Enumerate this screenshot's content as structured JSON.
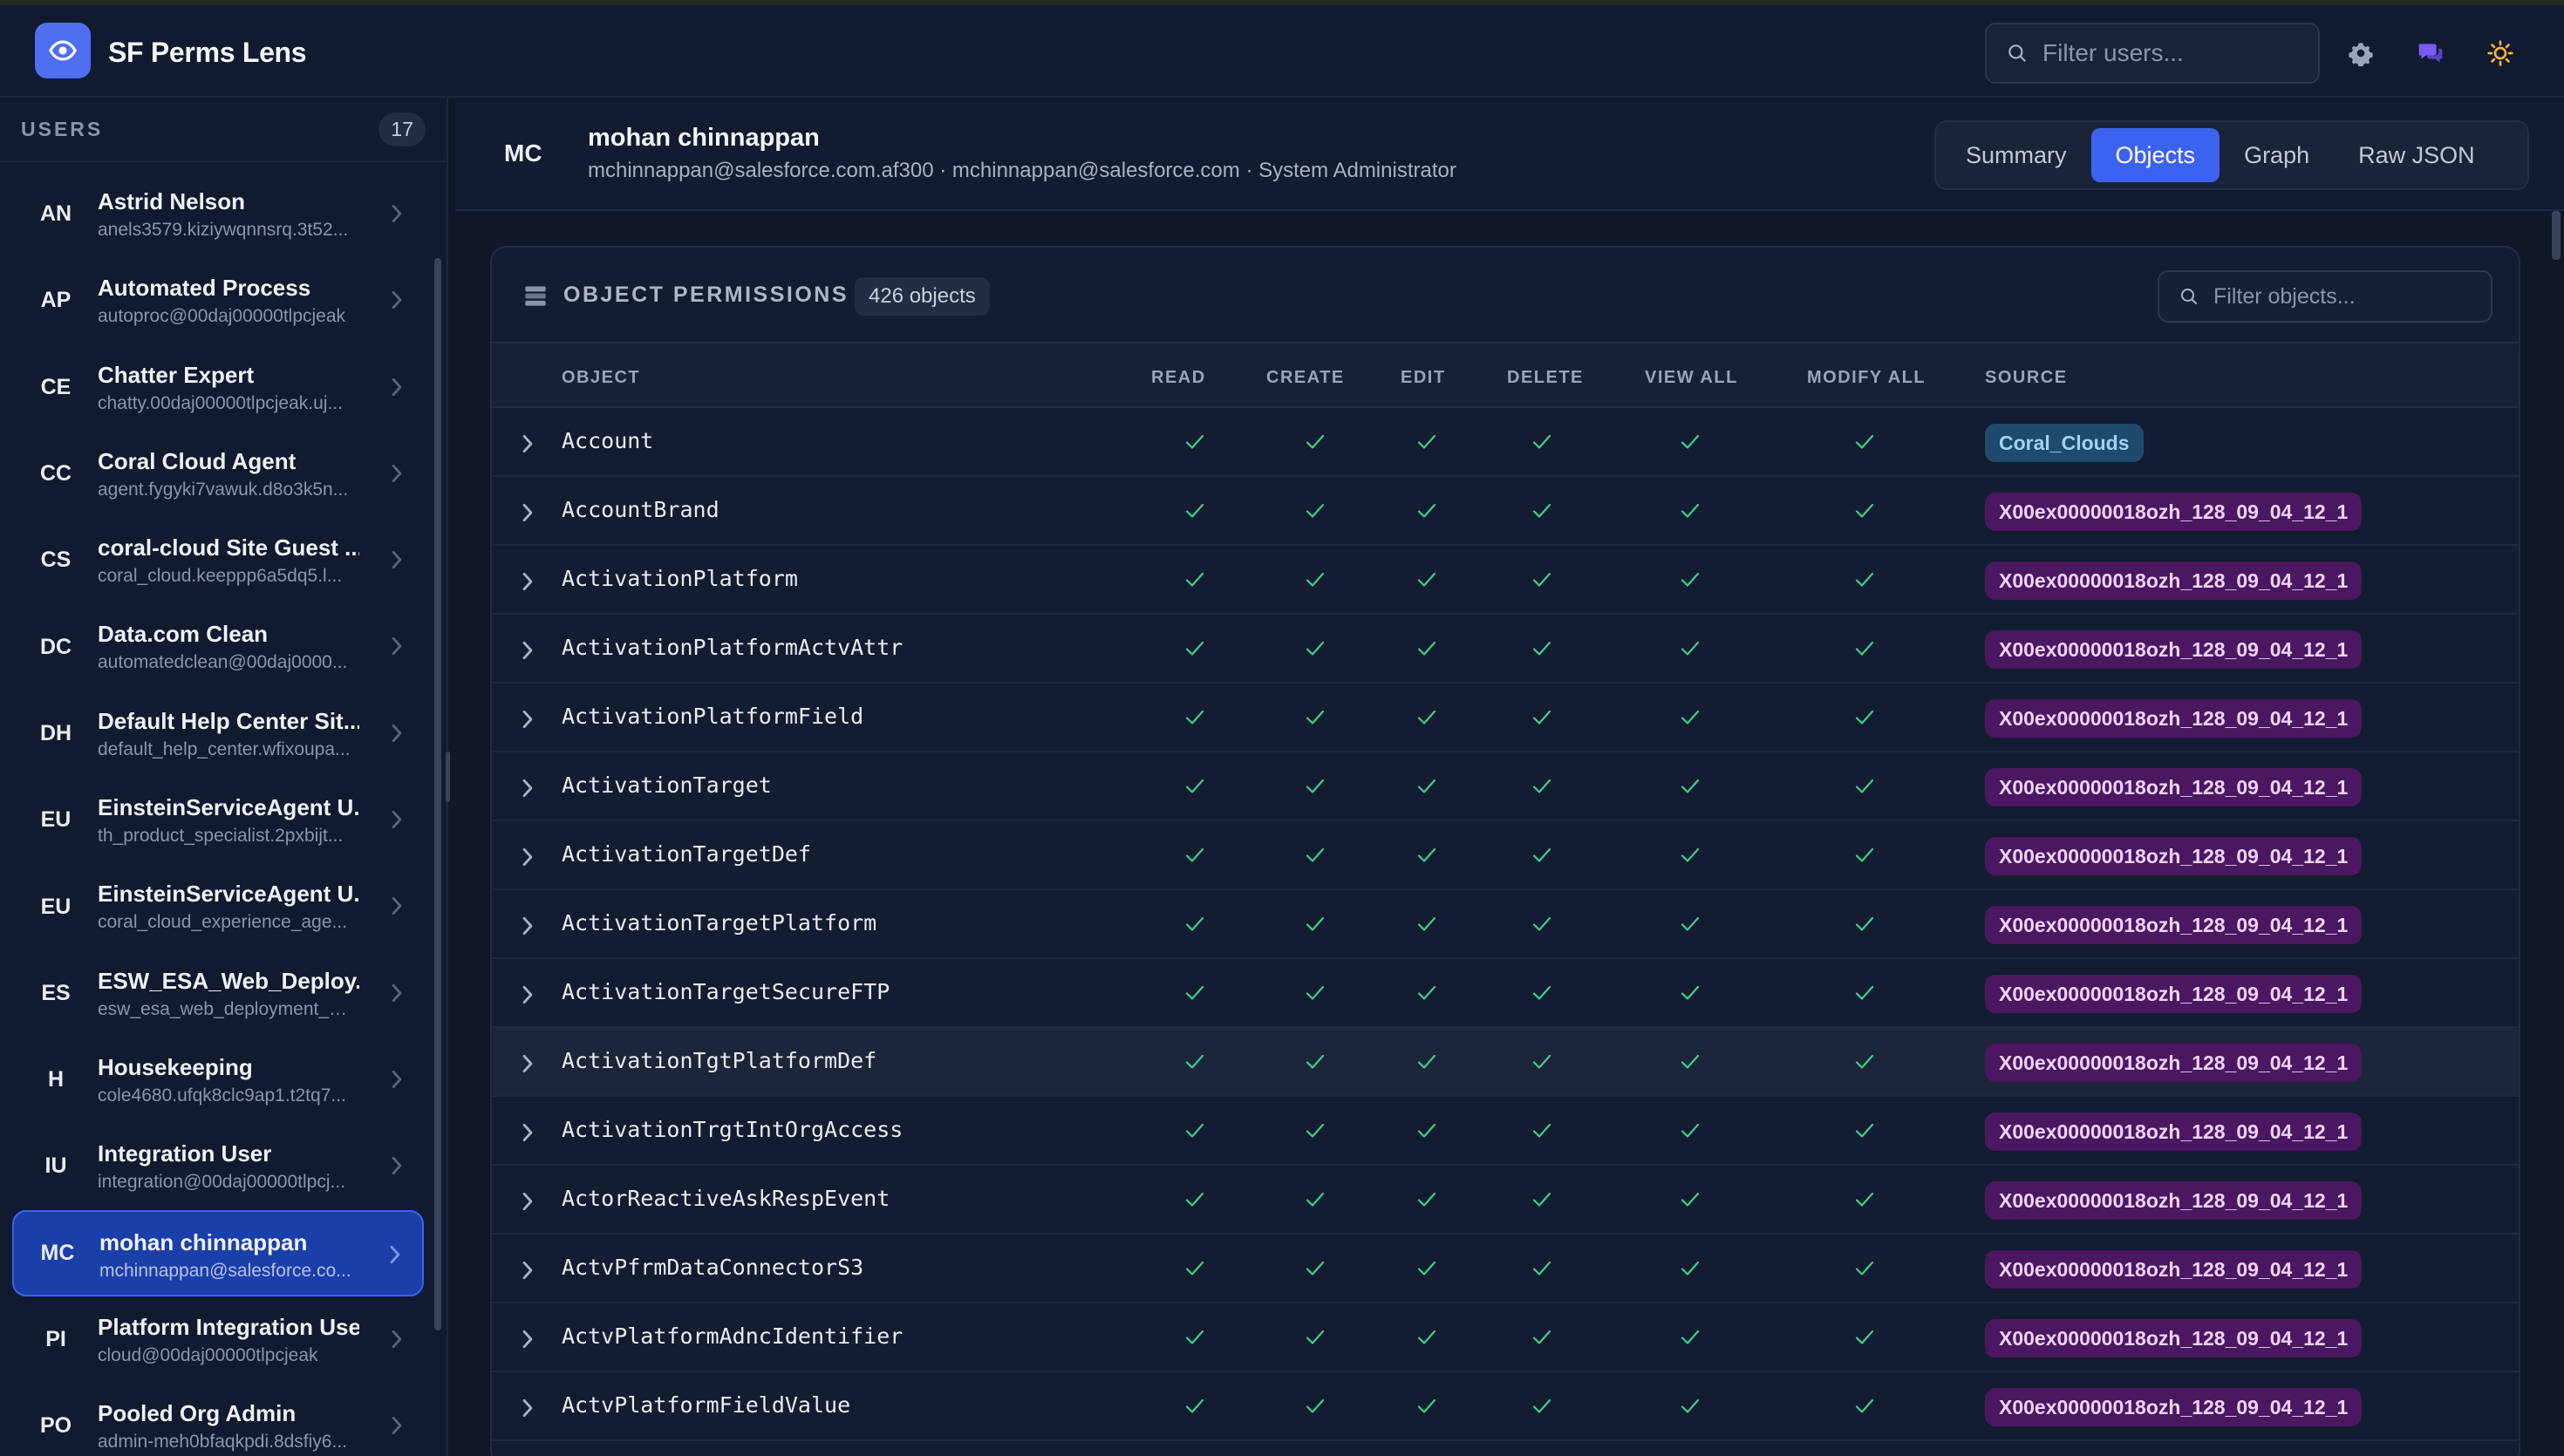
{
  "app": {
    "title": "SF Perms Lens"
  },
  "header": {
    "search_placeholder": "Filter users..."
  },
  "sidebar": {
    "label": "USERS",
    "count": "17",
    "users": [
      {
        "initials": "AN",
        "name": "Astrid Nelson",
        "sub": "anels3579.kiziywqnnsrq.3t52..."
      },
      {
        "initials": "AP",
        "name": "Automated Process",
        "sub": "autoproc@00daj00000tlpcjeak"
      },
      {
        "initials": "CE",
        "name": "Chatter Expert",
        "sub": "chatty.00daj00000tlpcjeak.uj..."
      },
      {
        "initials": "CC",
        "name": "Coral Cloud Agent",
        "sub": "agent.fygyki7vawuk.d8o3k5n..."
      },
      {
        "initials": "CS",
        "name": "coral-cloud Site Guest ...",
        "sub": "coral_cloud.keeppp6a5dq5.l..."
      },
      {
        "initials": "DC",
        "name": "Data.com Clean",
        "sub": "automatedclean@00daj0000..."
      },
      {
        "initials": "DH",
        "name": "Default Help Center Sit...",
        "sub": "default_help_center.wfixoupa..."
      },
      {
        "initials": "EU",
        "name": "EinsteinServiceAgent U...",
        "sub": "th_product_specialist.2pxbijt..."
      },
      {
        "initials": "EU",
        "name": "EinsteinServiceAgent U...",
        "sub": "coral_cloud_experience_age..."
      },
      {
        "initials": "ES",
        "name": "ESW_ESA_Web_Deploy...",
        "sub": "esw_esa_web_deployment_17..."
      },
      {
        "initials": "H",
        "name": "Housekeeping",
        "sub": "cole4680.ufqk8clc9ap1.t2tq7..."
      },
      {
        "initials": "IU",
        "name": "Integration User",
        "sub": "integration@00daj00000tlpcj..."
      },
      {
        "initials": "MC",
        "name": "mohan chinnappan",
        "sub": "mchinnappan@salesforce.co..."
      },
      {
        "initials": "PI",
        "name": "Platform Integration User",
        "sub": "cloud@00daj00000tlpcjeak"
      },
      {
        "initials": "PO",
        "name": "Pooled Org Admin",
        "sub": "admin-meh0bfaqkpdi.8dsfiy6..."
      }
    ],
    "active_index": 12
  },
  "profile": {
    "initials": "MC",
    "name": "mohan chinnappan",
    "details": "mchinnappan@salesforce.com.af300 · mchinnappan@salesforce.com · System Administrator"
  },
  "tabs": [
    {
      "label": "Summary",
      "active": false
    },
    {
      "label": "Objects",
      "active": true
    },
    {
      "label": "Graph",
      "active": false
    },
    {
      "label": "Raw JSON",
      "active": false
    }
  ],
  "panel": {
    "title": "OBJECT PERMISSIONS",
    "count": "426 objects",
    "filter_placeholder": "Filter objects...",
    "columns": {
      "object": "OBJECT",
      "read": "READ",
      "create": "CREATE",
      "edit": "EDIT",
      "delete": "DELETE",
      "view_all": "VIEW ALL",
      "modify_all": "MODIFY ALL",
      "source": "SOURCE"
    },
    "rows": [
      {
        "object": "Account",
        "source": "Coral_Clouds",
        "source_type": "coral"
      },
      {
        "object": "AccountBrand",
        "source": "X00ex00000018ozh_128_09_04_12_1",
        "source_type": "ps"
      },
      {
        "object": "ActivationPlatform",
        "source": "X00ex00000018ozh_128_09_04_12_1",
        "source_type": "ps"
      },
      {
        "object": "ActivationPlatformActvAttr",
        "source": "X00ex00000018ozh_128_09_04_12_1",
        "source_type": "ps"
      },
      {
        "object": "ActivationPlatformField",
        "source": "X00ex00000018ozh_128_09_04_12_1",
        "source_type": "ps"
      },
      {
        "object": "ActivationTarget",
        "source": "X00ex00000018ozh_128_09_04_12_1",
        "source_type": "ps"
      },
      {
        "object": "ActivationTargetDef",
        "source": "X00ex00000018ozh_128_09_04_12_1",
        "source_type": "ps"
      },
      {
        "object": "ActivationTargetPlatform",
        "source": "X00ex00000018ozh_128_09_04_12_1",
        "source_type": "ps"
      },
      {
        "object": "ActivationTargetSecureFTP",
        "source": "X00ex00000018ozh_128_09_04_12_1",
        "source_type": "ps"
      },
      {
        "object": "ActivationTgtPlatformDef",
        "source": "X00ex00000018ozh_128_09_04_12_1",
        "source_type": "ps"
      },
      {
        "object": "ActivationTrgtIntOrgAccess",
        "source": "X00ex00000018ozh_128_09_04_12_1",
        "source_type": "ps"
      },
      {
        "object": "ActorReactiveAskRespEvent",
        "source": "X00ex00000018ozh_128_09_04_12_1",
        "source_type": "ps"
      },
      {
        "object": "ActvPfrmDataConnectorS3",
        "source": "X00ex00000018ozh_128_09_04_12_1",
        "source_type": "ps"
      },
      {
        "object": "ActvPlatformAdncIdentifier",
        "source": "X00ex00000018ozh_128_09_04_12_1",
        "source_type": "ps"
      },
      {
        "object": "ActvPlatformFieldValue",
        "source": "X00ex00000018ozh_128_09_04_12_1",
        "source_type": "ps"
      }
    ],
    "hover_index": 9
  },
  "colors": {
    "accent": "#3c63f0",
    "check": "#3ccf8e",
    "coral_badge": "#1f4a6e",
    "ps_badge": "#4a1760"
  },
  "icons": {
    "logo": "eye-icon",
    "search": "search-icon",
    "settings": "gear-icon",
    "feedback": "chat-icon",
    "theme": "sun-icon",
    "panel": "database-icon",
    "expand": "chevron-right-icon",
    "permission": "check-icon"
  }
}
